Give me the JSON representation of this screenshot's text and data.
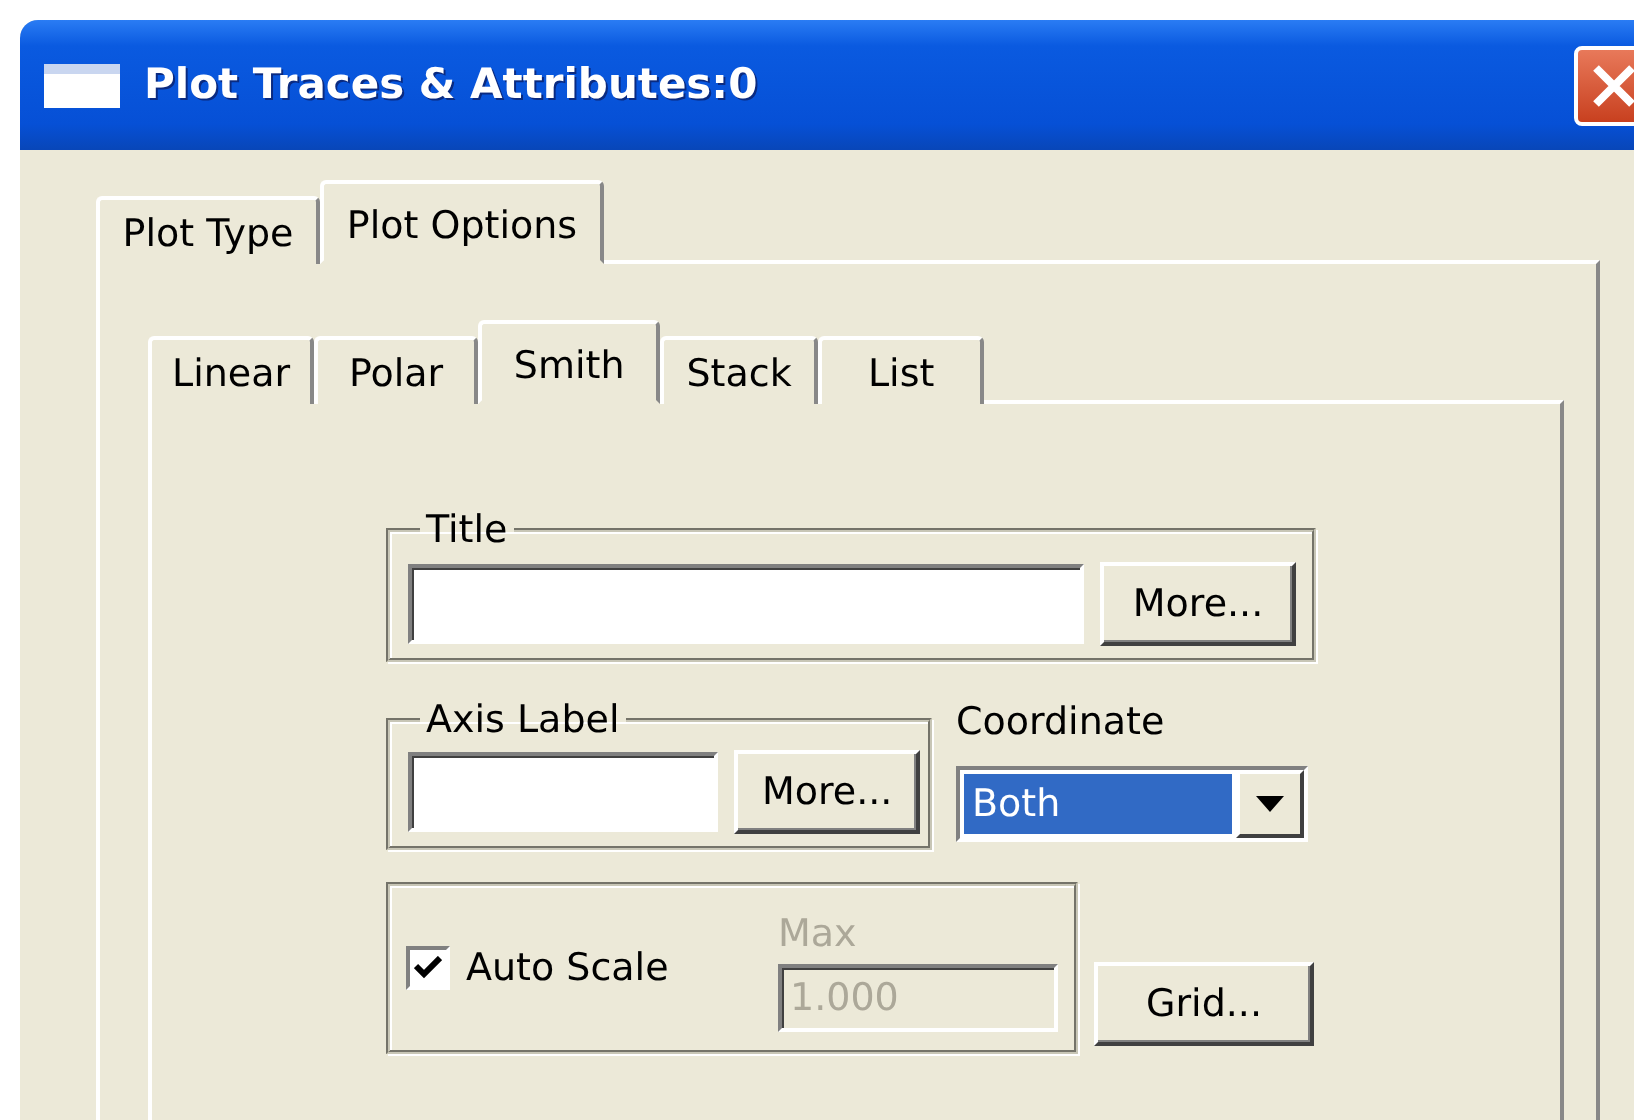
{
  "window": {
    "title": "Plot Traces & Attributes:0"
  },
  "outer_tabs": [
    {
      "label": "Plot Type",
      "selected": false
    },
    {
      "label": "Plot Options",
      "selected": true
    }
  ],
  "inner_tabs": [
    {
      "label": "Linear",
      "selected": false
    },
    {
      "label": "Polar",
      "selected": false
    },
    {
      "label": "Smith",
      "selected": true
    },
    {
      "label": "Stack",
      "selected": false
    },
    {
      "label": "List",
      "selected": false
    }
  ],
  "title_group": {
    "legend": "Title",
    "button": "More..."
  },
  "axis_label_group": {
    "legend": "Axis Label",
    "button": "More..."
  },
  "coordinate": {
    "label": "Coordinate",
    "value": "Both"
  },
  "scale_group": {
    "auto_scale": {
      "label": "Auto Scale",
      "checked": true
    },
    "max": {
      "label": "Max",
      "value": "1.000",
      "disabled": true
    }
  },
  "grid_button": "Grid..."
}
